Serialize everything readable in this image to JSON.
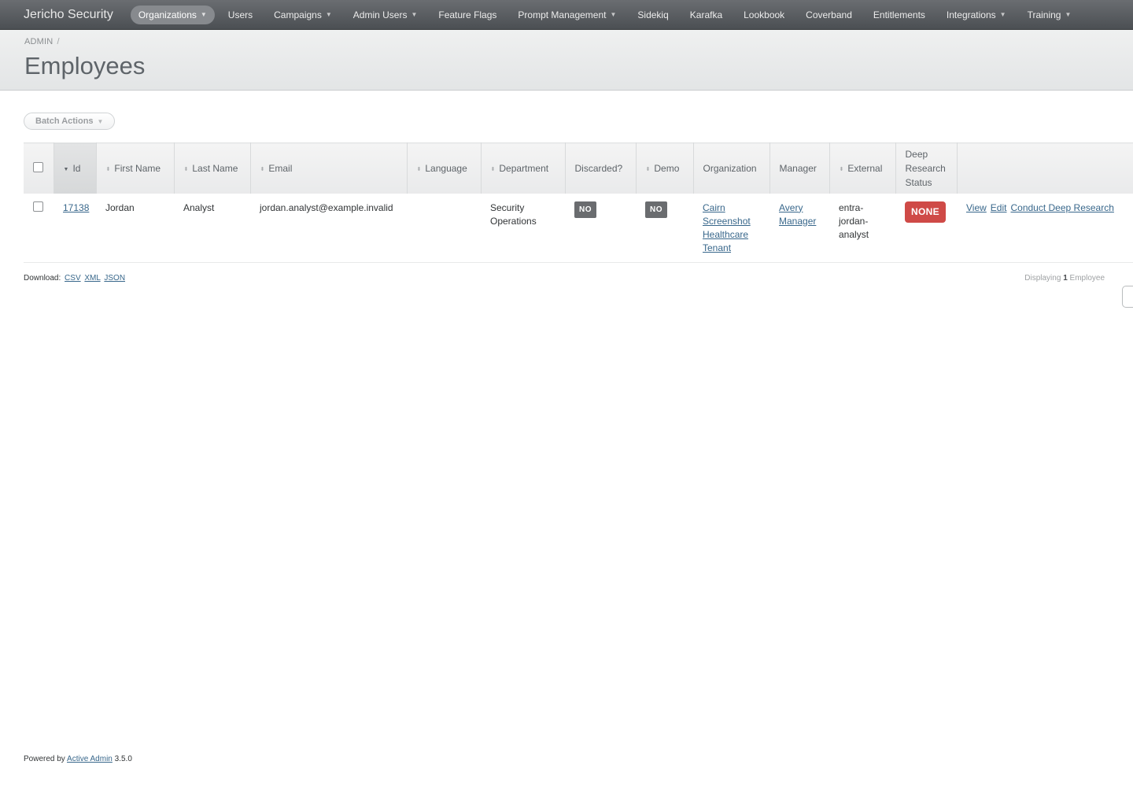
{
  "brand": "Jericho Security",
  "nav": [
    {
      "label": "Organizations",
      "dropdown": true,
      "active": true
    },
    {
      "label": "Users",
      "dropdown": false
    },
    {
      "label": "Campaigns",
      "dropdown": true
    },
    {
      "label": "Admin Users",
      "dropdown": true
    },
    {
      "label": "Feature Flags",
      "dropdown": false
    },
    {
      "label": "Prompt Management",
      "dropdown": true
    },
    {
      "label": "Sidekiq",
      "dropdown": false
    },
    {
      "label": "Karafka",
      "dropdown": false
    },
    {
      "label": "Lookbook",
      "dropdown": false
    },
    {
      "label": "Coverband",
      "dropdown": false
    },
    {
      "label": "Entitlements",
      "dropdown": false
    },
    {
      "label": "Integrations",
      "dropdown": true
    },
    {
      "label": "Training",
      "dropdown": true
    }
  ],
  "breadcrumb": {
    "item": "ADMIN",
    "separator": "/"
  },
  "page_title": "Employees",
  "batch_actions_label": "Batch Actions",
  "table": {
    "headers": {
      "id": "Id",
      "first_name": "First Name",
      "last_name": "Last Name",
      "email": "Email",
      "language": "Language",
      "department": "Department",
      "discarded": "Discarded?",
      "demo": "Demo",
      "organization": "Organization",
      "manager": "Manager",
      "external": "External",
      "deep_research_status": "Deep Research Status"
    },
    "sorted_column": "id",
    "rows": [
      {
        "id": "17138",
        "first_name": "Jordan",
        "last_name": "Analyst",
        "email": "jordan.analyst@example.invalid",
        "language": "",
        "department": "Security Operations",
        "discarded": "NO",
        "demo": "NO",
        "organization": "Cairn Screenshot Healthcare Tenant",
        "manager": "Avery Manager",
        "external": "entra-jordan-analyst",
        "deep_research_status": "NONE",
        "actions": {
          "view": "View",
          "edit": "Edit",
          "research": "Conduct Deep Research"
        }
      }
    ]
  },
  "download": {
    "label": "Download:",
    "formats": [
      "CSV",
      "XML",
      "JSON"
    ]
  },
  "pagination": {
    "prefix": "Displaying",
    "count": "1",
    "noun": "Employee"
  },
  "footer": {
    "prefix": "Powered by",
    "link": "Active Admin",
    "version": "3.5.0"
  },
  "colors": {
    "nav_bg": "#5a5e62",
    "status_none": "#cf4a47",
    "tag_bg": "#6a6c6f",
    "link": "#38678b"
  }
}
